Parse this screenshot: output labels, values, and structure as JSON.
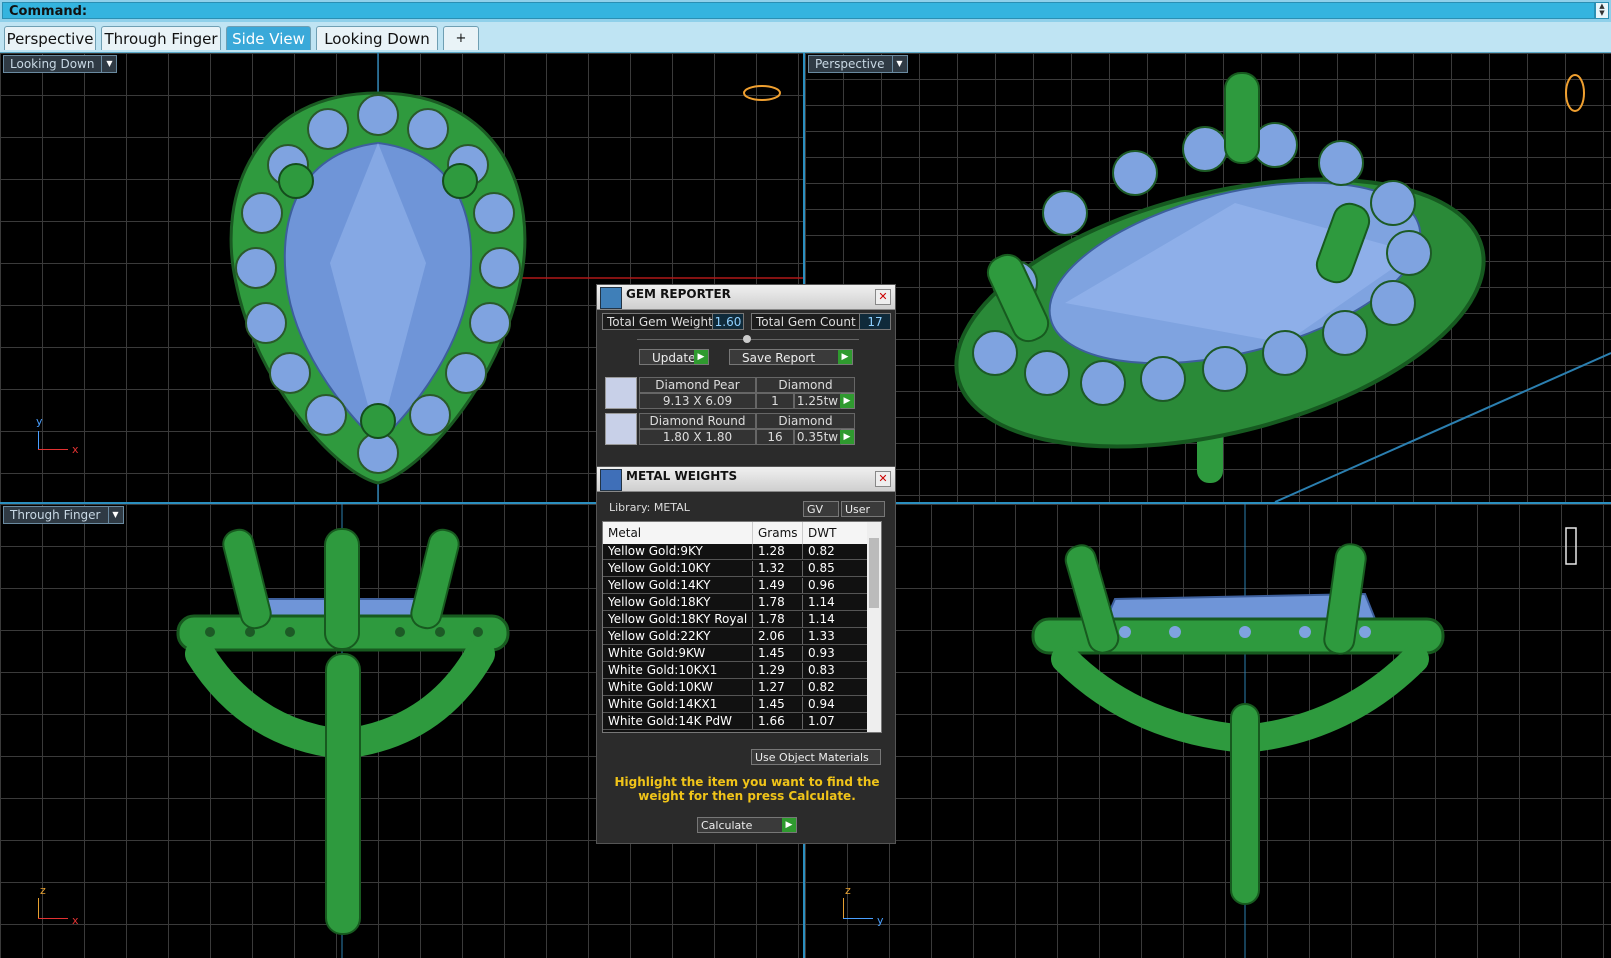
{
  "command": {
    "label": "Command:"
  },
  "tabs": [
    {
      "label": "Perspective",
      "active": false
    },
    {
      "label": "Through Finger",
      "active": false
    },
    {
      "label": "Side View",
      "active": true
    },
    {
      "label": "Looking Down",
      "active": false
    },
    {
      "label": "+",
      "active": false
    }
  ],
  "viewports": {
    "top_left": {
      "label": "Looking Down",
      "axis_v": "y",
      "axis_h": "x"
    },
    "top_right": {
      "label": "Perspective"
    },
    "bottom_left": {
      "label": "Through Finger",
      "axis_v": "z",
      "axis_h": "x"
    },
    "bottom_right": {
      "label": "",
      "axis_v": "z",
      "axis_h": "y"
    }
  },
  "gem_reporter": {
    "title": "GEM REPORTER",
    "total_weight_label": "Total Gem Weight",
    "total_weight": "1.60",
    "total_count_label": "Total Gem Count",
    "total_count": "17",
    "update_label": "Update",
    "save_label": "Save Report",
    "gems": [
      {
        "shape": "Diamond Pear",
        "size": "9.13 X 6.09",
        "material": "Diamond",
        "count": "1",
        "weight": "1.25tw"
      },
      {
        "shape": "Diamond Round",
        "size": "1.80 X 1.80",
        "material": "Diamond",
        "count": "16",
        "weight": "0.35tw"
      }
    ]
  },
  "metal_weights": {
    "title": "METAL WEIGHTS",
    "library_label": "Library: METAL",
    "gv_label": "GV",
    "user_label": "User",
    "columns": [
      "Metal",
      "Grams",
      "DWT"
    ],
    "rows": [
      {
        "metal": "Yellow Gold:9KY",
        "grams": "1.28",
        "dwt": "0.82"
      },
      {
        "metal": "Yellow Gold:10KY",
        "grams": "1.32",
        "dwt": "0.85"
      },
      {
        "metal": "Yellow Gold:14KY",
        "grams": "1.49",
        "dwt": "0.96"
      },
      {
        "metal": "Yellow Gold:18KY",
        "grams": "1.78",
        "dwt": "1.14"
      },
      {
        "metal": "Yellow Gold:18KY Royal",
        "grams": "1.78",
        "dwt": "1.14"
      },
      {
        "metal": "Yellow Gold:22KY",
        "grams": "2.06",
        "dwt": "1.33"
      },
      {
        "metal": "White Gold:9KW",
        "grams": "1.45",
        "dwt": "0.93"
      },
      {
        "metal": "White Gold:10KX1",
        "grams": "1.29",
        "dwt": "0.83"
      },
      {
        "metal": "White Gold:10KW",
        "grams": "1.27",
        "dwt": "0.82"
      },
      {
        "metal": "White Gold:14KX1",
        "grams": "1.45",
        "dwt": "0.94"
      },
      {
        "metal": "White Gold:14K PdW",
        "grams": "1.66",
        "dwt": "1.07"
      }
    ],
    "use_object_materials_label": "Use Object Materials",
    "hint": "Highlight the item you want to find the weight for then press Calculate.",
    "calculate_label": "Calculate"
  },
  "colors": {
    "accent": "#34b4df",
    "metal": "#2e9a3e",
    "gem": "#7fa3e0",
    "hint": "#f0c419"
  }
}
